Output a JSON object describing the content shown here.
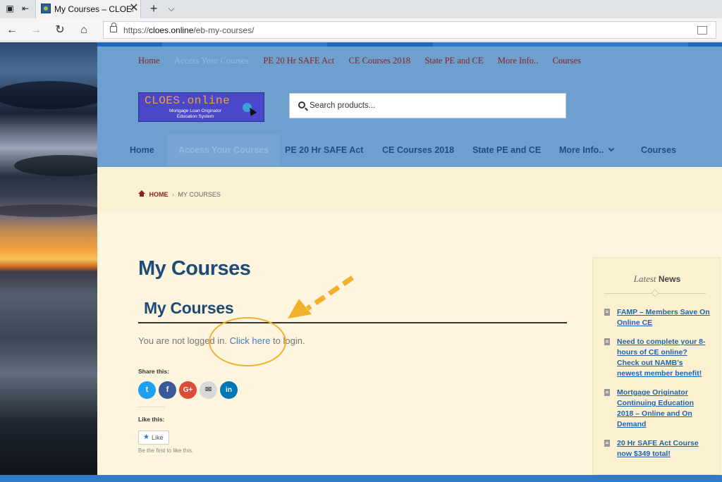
{
  "browser": {
    "tab_title": "My Courses – CLOES.on",
    "url_prefix": "https://",
    "url_domain": "cloes.online",
    "url_path": "/eb-my-courses/",
    "close_glyph": "✕",
    "new_tab_glyph": "+",
    "tab_menu_glyph": "⌵",
    "back_glyph": "←",
    "forward_glyph": "→",
    "refresh_glyph": "↻",
    "home_glyph": "⌂"
  },
  "top_nav": {
    "items": [
      "Home",
      "Access Your Courses",
      "PE 20 Hr SAFE Act",
      "CE Courses 2018",
      "State PE and CE",
      "More Info..",
      "Courses"
    ]
  },
  "logo": {
    "line1": "CLOES.online",
    "line2": "Mortgage Loan Originator",
    "line3": "Education System"
  },
  "search": {
    "placeholder": "Search products..."
  },
  "main_nav": {
    "items": [
      "Home",
      "Access Your Courses",
      "PE 20 Hr SAFE Act",
      "CE Courses 2018",
      "State PE and CE",
      "More Info..",
      "Courses"
    ]
  },
  "breadcrumb": {
    "home": "HOME",
    "separator": "›",
    "current": "MY COURSES"
  },
  "page": {
    "title": "My Courses",
    "subtitle": "My Courses",
    "msg_before": "You are not logged in. ",
    "msg_link": "Click here",
    "msg_after": " to login."
  },
  "share": {
    "label": "Share this:",
    "buttons": [
      {
        "name": "twitter",
        "glyph": "t",
        "color": "#1da1f2"
      },
      {
        "name": "facebook",
        "glyph": "f",
        "color": "#3b5998"
      },
      {
        "name": "google-plus",
        "glyph": "G+",
        "color": "#dd4b39"
      },
      {
        "name": "email",
        "glyph": "✉",
        "color": "#d8d8d8"
      },
      {
        "name": "linkedin",
        "glyph": "in",
        "color": "#0077b5"
      }
    ]
  },
  "like": {
    "label": "Like this:",
    "button": "Like",
    "sub": "Be the first to like this."
  },
  "widget": {
    "title_italic": "Latest",
    "title_bold": "News",
    "items": [
      "FAMP – Members Save On Online CE",
      "Need to complete your 8-hours of CE online? Check out NAMB’s newest member benefit!",
      "Mortgage Originator Continuing Education 2018 – Online and On Demand",
      "20 Hr SAFE Act Course now $349 total!"
    ]
  },
  "colors": {
    "header_bg": "#6ea0cf",
    "content_bg": "#fdf5dd",
    "heading": "#1e4a78",
    "link": "#3a7ec0",
    "annotation": "#f1b12a"
  }
}
